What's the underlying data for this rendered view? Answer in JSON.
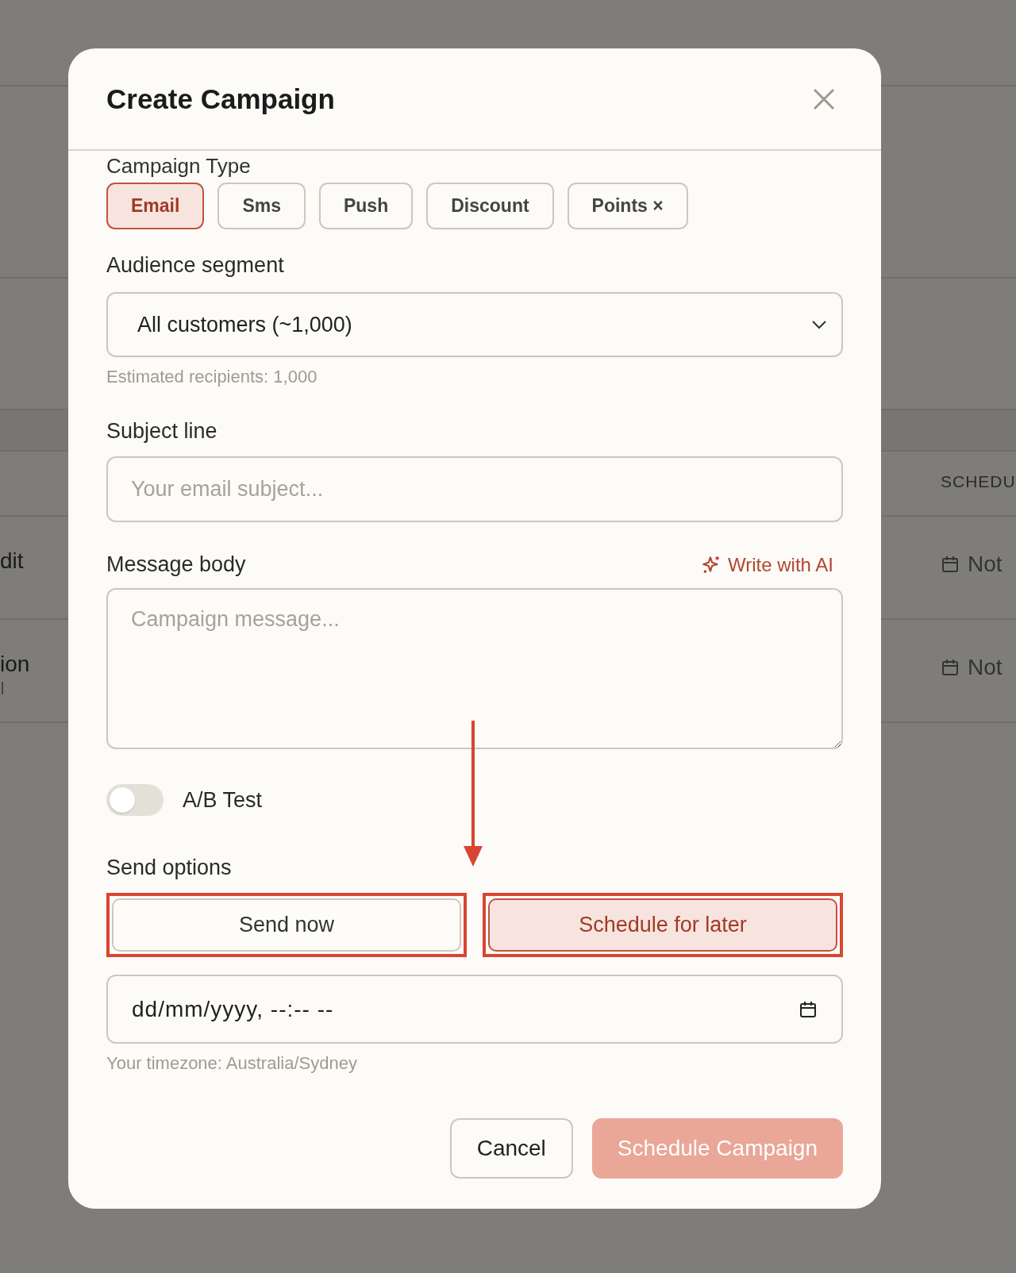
{
  "background": {
    "row_texts": [
      "dit",
      "ion"
    ],
    "column_header": "SCHEDU",
    "schedule_cells": [
      "Not",
      "Not"
    ]
  },
  "dialog": {
    "title": "Create Campaign",
    "campaign_type": {
      "label": "Campaign Type",
      "options": [
        {
          "label": "Email",
          "selected": true
        },
        {
          "label": "Sms",
          "selected": false
        },
        {
          "label": "Push",
          "selected": false
        },
        {
          "label": "Discount",
          "selected": false
        },
        {
          "label": "Points ×",
          "selected": false
        }
      ]
    },
    "audience": {
      "label": "Audience segment",
      "value": "All customers (~1,000)",
      "hint": "Estimated recipients: 1,000"
    },
    "subject": {
      "label": "Subject line",
      "placeholder": "Your email subject..."
    },
    "message": {
      "label": "Message body",
      "ai_link": "Write with AI",
      "placeholder": "Campaign message..."
    },
    "ab_test": {
      "label": "A/B Test",
      "on": false
    },
    "send_options": {
      "label": "Send options",
      "options": [
        {
          "label": "Send now",
          "selected": false,
          "highlighted": true
        },
        {
          "label": "Schedule for later",
          "selected": true,
          "highlighted": true
        }
      ]
    },
    "schedule": {
      "value": "dd/mm/yyyy, --:-- --",
      "hint": "Your timezone: Australia/Sydney"
    },
    "buttons": [
      {
        "label": "Cancel",
        "kind": "secondary",
        "disabled": false
      },
      {
        "label": "Schedule Campaign",
        "kind": "primary",
        "disabled": true
      }
    ]
  }
}
